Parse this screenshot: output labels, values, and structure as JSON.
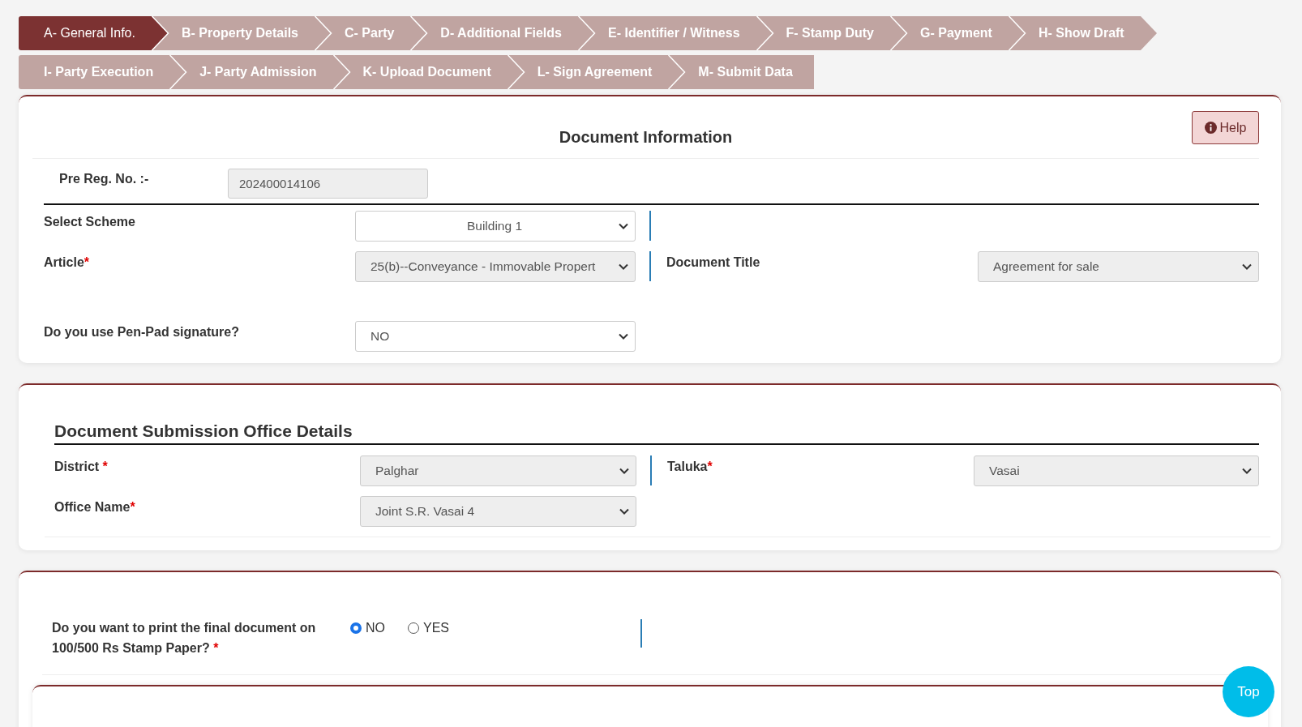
{
  "tab_rows": [
    {
      "tabs": [
        {
          "label": "A- General Info.",
          "selected": true
        },
        {
          "label": "B- Property Details",
          "selected": false
        },
        {
          "label": "C- Party",
          "selected": false
        },
        {
          "label": "D- Additional Fields",
          "selected": false
        },
        {
          "label": "E- Identifier / Witness",
          "selected": false
        },
        {
          "label": "F- Stamp Duty",
          "selected": false
        },
        {
          "label": "G- Payment",
          "selected": false
        },
        {
          "label": "H- Show Draft",
          "selected": false
        }
      ]
    },
    {
      "tabs": [
        {
          "label": "I- Party Execution",
          "selected": false
        },
        {
          "label": "J- Party Admission",
          "selected": false
        },
        {
          "label": "K- Upload Document",
          "selected": false
        },
        {
          "label": "L- Sign Agreement",
          "selected": false
        },
        {
          "label": "M- Submit Data",
          "selected": false
        }
      ]
    }
  ],
  "document_information": {
    "title": "Document Information",
    "help_button": "Help",
    "pre_reg": {
      "label": "Pre Reg. No. :-",
      "value": "202400014106"
    },
    "rows": [
      {
        "separator": true,
        "left": {
          "label": "Select Scheme",
          "value": "Building 1",
          "disabled": false
        }
      },
      {
        "separator": true,
        "left": {
          "label": "Article",
          "mark": "*",
          "value": "25(b)--Conveyance - Immovable Propert",
          "disabled": true
        },
        "right": {
          "label": "Document Title",
          "value": "Agreement for sale",
          "disabled": true
        }
      },
      {
        "separator": false,
        "left": {
          "label": "Do you use Pen-Pad signature?",
          "value": "NO",
          "disabled": false
        }
      }
    ]
  },
  "office_details": {
    "title": "Document Submission Office Details",
    "rows": [
      {
        "separator": true,
        "left": {
          "label": "District",
          "mark": " *",
          "value": "Palghar",
          "disabled": true
        },
        "right": {
          "label": "Taluka",
          "mark": "*",
          "value": "Vasai",
          "disabled": true
        }
      },
      {
        "separator": false,
        "left": {
          "label": "Office Name",
          "mark": "*",
          "value": "Joint S.R. Vasai 4",
          "disabled": true
        }
      }
    ]
  },
  "stamp_paper": {
    "question": "Do you want to print the final document on 100/500 Rs Stamp Paper?",
    "mark": " *",
    "separator": true,
    "options": [
      {
        "label": "NO",
        "selected": true
      },
      {
        "label": "YES",
        "selected": false
      }
    ]
  },
  "top_button": "Top"
}
